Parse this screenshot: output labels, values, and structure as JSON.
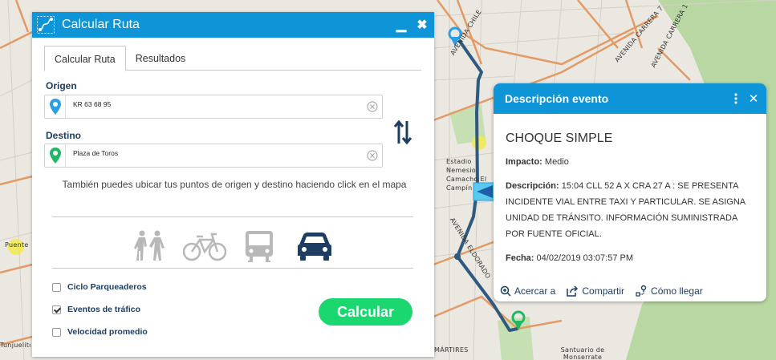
{
  "map": {
    "street_labels": [
      "AVENIDA CHILE",
      "AVENIDA CARRERA 7",
      "AVENIDA CARRERA 1",
      "AVENIDA ELDORADO",
      "MÁRTIRES",
      "Estadio Nemesio Camacho El Campín",
      "Santuario de Monserrate",
      "Puente Aranda",
      "Tunjuelito"
    ]
  },
  "route_panel": {
    "title": "Calcular Ruta",
    "minimize": "▁",
    "close": "✖",
    "tabs": [
      {
        "label": "Calcular Ruta",
        "active": true
      },
      {
        "label": "Resultados",
        "active": false
      }
    ],
    "origin": {
      "label": "Origen",
      "value": "KR 63 68 95",
      "pin_color": "#2a9ee6"
    },
    "destination": {
      "label": "Destino",
      "value": "Plaza de Toros",
      "pin_color": "#21b765"
    },
    "hint": "También puedes ubicar tus puntos de origen y destino haciendo click en el mapa",
    "modes": [
      {
        "icon": "walking-icon",
        "selected": false
      },
      {
        "icon": "bicycle-icon",
        "selected": false
      },
      {
        "icon": "bus-icon",
        "selected": false
      },
      {
        "icon": "car-icon",
        "selected": true
      }
    ],
    "options": [
      {
        "label": "Ciclo Parqueaderos",
        "checked": false
      },
      {
        "label": "Eventos de tráfico",
        "checked": true
      },
      {
        "label": "Velocidad promedio",
        "checked": false
      }
    ],
    "calculate_label": "Calcular"
  },
  "event_popup": {
    "title": "Descripción evento",
    "close": "✕",
    "event_name": "CHOQUE SIMPLE",
    "impact_label": "Impacto:",
    "impact_value": "Medio",
    "description_label": "Descripción:",
    "description_value": "15:04 CLL 52 A X CRA 27 A : SE PRESENTA INCIDENTE VIAL ENTRE TAXI Y PARTICULAR. SE ASIGNA UNIDAD DE TRÁNSITO. INFORMACIÓN SUMINISTRADA POR FUENTE OFICIAL.",
    "date_label": "Fecha:",
    "date_value": "04/02/2019 03:07:57 PM",
    "actions": [
      "Acercar a",
      "Compartir",
      "Cómo llegar"
    ]
  },
  "colors": {
    "header_blue": "#0d95d8",
    "dark_navy": "#1d3d63",
    "calc_green": "#1ad86f",
    "route_line": "#2f5a80",
    "road_orange": "#e39a64",
    "park_green": "#b9d7a3"
  }
}
